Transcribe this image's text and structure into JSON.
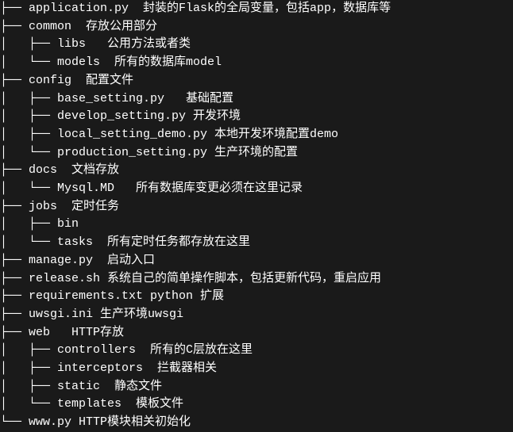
{
  "tree": [
    {
      "prefix": "├── ",
      "name": "application.py",
      "desc": "  封装的Flask的全局变量，包括app，数据库等"
    },
    {
      "prefix": "├── ",
      "name": "common",
      "desc": "  存放公用部分"
    },
    {
      "prefix": "│   ├── ",
      "name": "libs",
      "desc": "   公用方法或者类"
    },
    {
      "prefix": "│   └── ",
      "name": "models",
      "desc": "  所有的数据库model"
    },
    {
      "prefix": "├── ",
      "name": "config",
      "desc": "  配置文件"
    },
    {
      "prefix": "│   ├── ",
      "name": "base_setting.py",
      "desc": "   基础配置"
    },
    {
      "prefix": "│   ├── ",
      "name": "develop_setting.py",
      "desc": " 开发环境"
    },
    {
      "prefix": "│   ├── ",
      "name": "local_setting_demo.py",
      "desc": " 本地开发环境配置demo"
    },
    {
      "prefix": "│   └── ",
      "name": "production_setting.py",
      "desc": " 生产环境的配置"
    },
    {
      "prefix": "├── ",
      "name": "docs",
      "desc": "  文档存放"
    },
    {
      "prefix": "│   └── ",
      "name": "Mysql.MD",
      "desc": "   所有数据库变更必须在这里记录"
    },
    {
      "prefix": "├── ",
      "name": "jobs",
      "desc": "  定时任务"
    },
    {
      "prefix": "│   ├── ",
      "name": "bin",
      "desc": ""
    },
    {
      "prefix": "│   └── ",
      "name": "tasks",
      "desc": "  所有定时任务都存放在这里"
    },
    {
      "prefix": "├── ",
      "name": "manage.py",
      "desc": "  启动入口"
    },
    {
      "prefix": "├── ",
      "name": "release.sh",
      "desc": " 系统自己的简单操作脚本，包括更新代码，重启应用"
    },
    {
      "prefix": "├── ",
      "name": "requirements.txt",
      "desc": " python 扩展"
    },
    {
      "prefix": "├── ",
      "name": "uwsgi.ini",
      "desc": " 生产环境uwsgi"
    },
    {
      "prefix": "├── ",
      "name": "web",
      "desc": "   HTTP存放"
    },
    {
      "prefix": "│   ├── ",
      "name": "controllers",
      "desc": "  所有的C层放在这里"
    },
    {
      "prefix": "│   ├── ",
      "name": "interceptors",
      "desc": "  拦截器相关"
    },
    {
      "prefix": "│   ├── ",
      "name": "static",
      "desc": "  静态文件"
    },
    {
      "prefix": "│   └── ",
      "name": "templates",
      "desc": "  模板文件"
    },
    {
      "prefix": "└── ",
      "name": "www.py",
      "desc": " HTTP模块相关初始化"
    }
  ]
}
